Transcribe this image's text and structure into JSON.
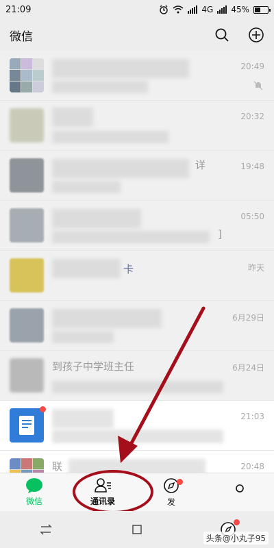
{
  "status": {
    "time": "21:09",
    "network": "4G",
    "battery": "45%",
    "battery_level": 0.45
  },
  "header": {
    "title": "微信"
  },
  "chats": [
    {
      "time": "20:49",
      "text": "",
      "muted": true
    },
    {
      "time": "20:32",
      "text": ""
    },
    {
      "time": "19:48",
      "text": "详"
    },
    {
      "time": "05:50",
      "text": "]"
    },
    {
      "time": "昨天",
      "text": "卡"
    },
    {
      "time": "6月29日",
      "text": ""
    },
    {
      "time": "6月24日",
      "text": "到孩子中学班主任"
    },
    {
      "time": "21:03",
      "text": ""
    },
    {
      "time": "20:48",
      "text": "联"
    }
  ],
  "tabs": [
    {
      "label": "微信",
      "active": true
    },
    {
      "label": "通讯录",
      "active": false
    },
    {
      "label": "发",
      "active": false
    },
    {
      "label": "",
      "active": false
    }
  ],
  "watermark": "头条@小丸子95",
  "colors": {
    "wechat_green": "#07c160",
    "annotation_red": "#a40f1b",
    "badge_red": "#f54a45"
  }
}
